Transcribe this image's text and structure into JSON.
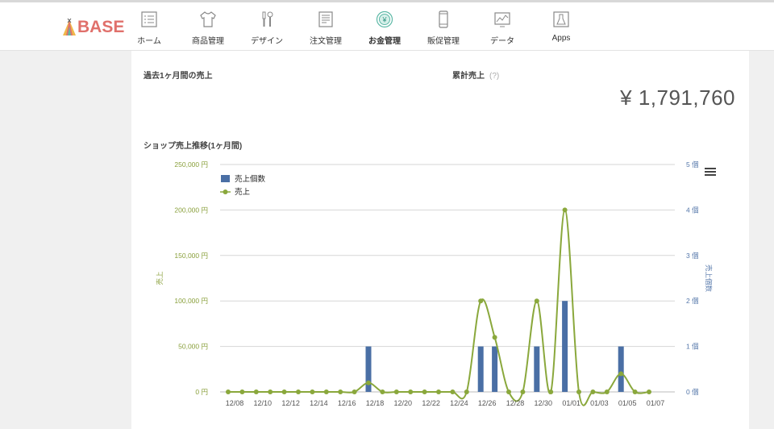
{
  "header": {
    "logo_text": "BASE",
    "nav": [
      {
        "label": "ホーム",
        "icon": "home-checklist-icon"
      },
      {
        "label": "商品管理",
        "icon": "shirt-icon"
      },
      {
        "label": "デザイン",
        "icon": "tools-icon"
      },
      {
        "label": "注文管理",
        "icon": "order-document-icon"
      },
      {
        "label": "お金管理",
        "icon": "yen-coin-icon",
        "active": true
      },
      {
        "label": "販促管理",
        "icon": "smartphone-icon"
      },
      {
        "label": "データ",
        "icon": "chart-monitor-icon"
      },
      {
        "label": "Apps",
        "icon": "flask-icon"
      }
    ]
  },
  "summary": {
    "past_month_label": "過去1ヶ月間の売上",
    "cumulative_label": "累計売上",
    "help_mark": "(?)",
    "cumulative_value": "¥ 1,791,760"
  },
  "chart_title": "ショップ売上推移(1ヶ月間)",
  "colors": {
    "bar": "#4a6fa5",
    "line": "#8aa83c",
    "accent": "#e0706b"
  },
  "chart_data": {
    "type": "bar+line",
    "x": [
      "12/08",
      "12/09",
      "12/10",
      "12/11",
      "12/12",
      "12/13",
      "12/14",
      "12/15",
      "12/16",
      "12/17",
      "12/18",
      "12/19",
      "12/20",
      "12/21",
      "12/22",
      "12/23",
      "12/24",
      "12/25",
      "12/26",
      "12/27",
      "12/28",
      "12/29",
      "12/30",
      "12/31",
      "01/01",
      "01/02",
      "01/03",
      "01/04",
      "01/05",
      "01/06",
      "01/07"
    ],
    "x_tick_labels": [
      "12/08",
      "12/10",
      "12/12",
      "12/14",
      "12/16",
      "12/18",
      "12/20",
      "12/22",
      "12/24",
      "12/26",
      "12/28",
      "12/30",
      "01/01",
      "01/03",
      "01/05",
      "01/07"
    ],
    "series": [
      {
        "name": "売上個数",
        "type": "bar",
        "axis": "right",
        "values": [
          0,
          0,
          0,
          0,
          0,
          0,
          0,
          0,
          0,
          0,
          1,
          0,
          0,
          0,
          0,
          0,
          0,
          0,
          1,
          1,
          0,
          0,
          1,
          0,
          2,
          0,
          0,
          0,
          1,
          0,
          0
        ]
      },
      {
        "name": "売上",
        "type": "line",
        "axis": "left",
        "values": [
          0,
          0,
          0,
          0,
          0,
          0,
          0,
          0,
          0,
          0,
          10000,
          0,
          0,
          0,
          0,
          0,
          0,
          0,
          100000,
          60000,
          0,
          0,
          100000,
          0,
          200000,
          0,
          0,
          0,
          20000,
          0,
          0
        ]
      }
    ],
    "ylabel_left": "売上",
    "ylabel_right": "売上個数",
    "y_left_ticks": [
      "0 円",
      "50,000 円",
      "100,000 円",
      "150,000 円",
      "200,000 円",
      "250,000 円"
    ],
    "y_right_ticks": [
      "0 個",
      "1 個",
      "2 個",
      "3 個",
      "4 個",
      "5 個"
    ],
    "ylim_left": [
      0,
      250000
    ],
    "ylim_right": [
      0,
      5
    ],
    "grid": true,
    "legend_position": "top-left",
    "menu_icon": "hamburger-menu-icon"
  }
}
